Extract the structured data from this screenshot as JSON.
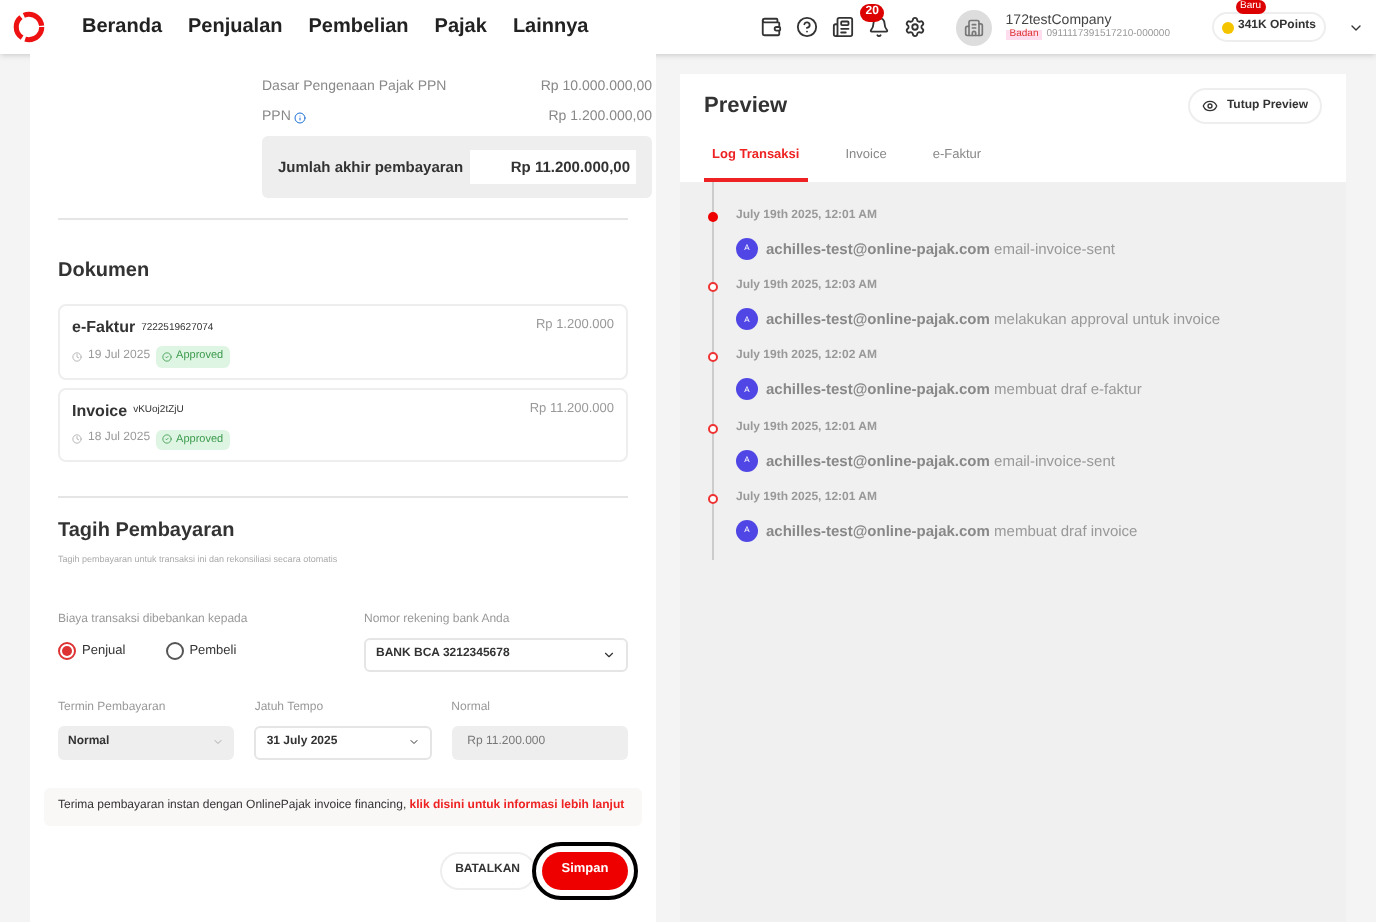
{
  "nav": {
    "items": [
      "Beranda",
      "Penjualan",
      "Pembelian",
      "Pajak",
      "Lainnya"
    ],
    "notification_count": "20",
    "company": {
      "name": "172testCompany",
      "type": "Badan",
      "npwp": "0911117391517210-000000"
    },
    "points": {
      "badge": "Baru",
      "label": "341K OPoints"
    }
  },
  "summary": {
    "rows": [
      {
        "label": "Dasar Pengenaan Pajak PPN",
        "value": "Rp 10.000.000,00",
        "info": false
      },
      {
        "label": "PPN",
        "value": "Rp 1.200.000,00",
        "info": true
      }
    ],
    "total": {
      "label": "Jumlah akhir pembayaran",
      "value": "Rp 11.200.000,00"
    }
  },
  "documents": {
    "title": "Dokumen",
    "items": [
      {
        "name": "e-Faktur",
        "number": "7222519627074",
        "date": "19 Jul 2025",
        "status": "Approved",
        "amount": "Rp 1.200.000"
      },
      {
        "name": "Invoice",
        "number": "vKUoj2tZjU",
        "date": "18 Jul 2025",
        "status": "Approved",
        "amount": "Rp 11.200.000"
      }
    ]
  },
  "billing": {
    "title": "Tagih Pembayaran",
    "subtitle": "Tagih pembayaran untuk transaksi ini dan rekonsiliasi secara otomatis",
    "fee_label": "Biaya transaksi dibebankan kepada",
    "fee_options": [
      {
        "label": "Penjual",
        "selected": true
      },
      {
        "label": "Pembeli",
        "selected": false
      }
    ],
    "bank_label": "Nomor rekening bank Anda",
    "bank_value": "BANK BCA 3212345678",
    "term_label": "Termin Pembayaran",
    "term_value": "Normal",
    "due_label": "Jatuh Tempo",
    "due_value": "31 July 2025",
    "amount_label": "Normal",
    "amount_value": "Rp 11.200.000",
    "notice": "Terima pembayaran instan dengan OnlinePajak invoice financing,",
    "notice_link": "klik disini untuk informasi lebih lanjut",
    "cancel": "BATALKAN",
    "save": "Simpan"
  },
  "preview": {
    "title": "Preview",
    "close": "Tutup Preview",
    "tabs": [
      {
        "label": "Log Transaksi",
        "selected": true
      },
      {
        "label": "Invoice",
        "selected": false
      },
      {
        "label": "e-Faktur",
        "selected": false
      }
    ],
    "log": [
      {
        "time": "July 19th 2025, 12:01 AM",
        "avatar": "A",
        "user": "achilles-test@online-pajak.com",
        "action": "email-invoice-sent",
        "latest": true
      },
      {
        "time": "July 19th 2025, 12:03 AM",
        "avatar": "A",
        "user": "achilles-test@online-pajak.com",
        "action": "melakukan approval untuk invoice",
        "latest": false
      },
      {
        "time": "July 19th 2025, 12:02 AM",
        "avatar": "A",
        "user": "achilles-test@online-pajak.com",
        "action": "membuat draf e-faktur",
        "latest": false
      },
      {
        "time": "July 19th 2025, 12:01 AM",
        "avatar": "A",
        "user": "achilles-test@online-pajak.com",
        "action": "email-invoice-sent",
        "latest": false
      },
      {
        "time": "July 19th 2025, 12:01 AM",
        "avatar": "A",
        "user": "achilles-test@online-pajak.com",
        "action": "membuat draf invoice",
        "latest": false
      }
    ]
  }
}
